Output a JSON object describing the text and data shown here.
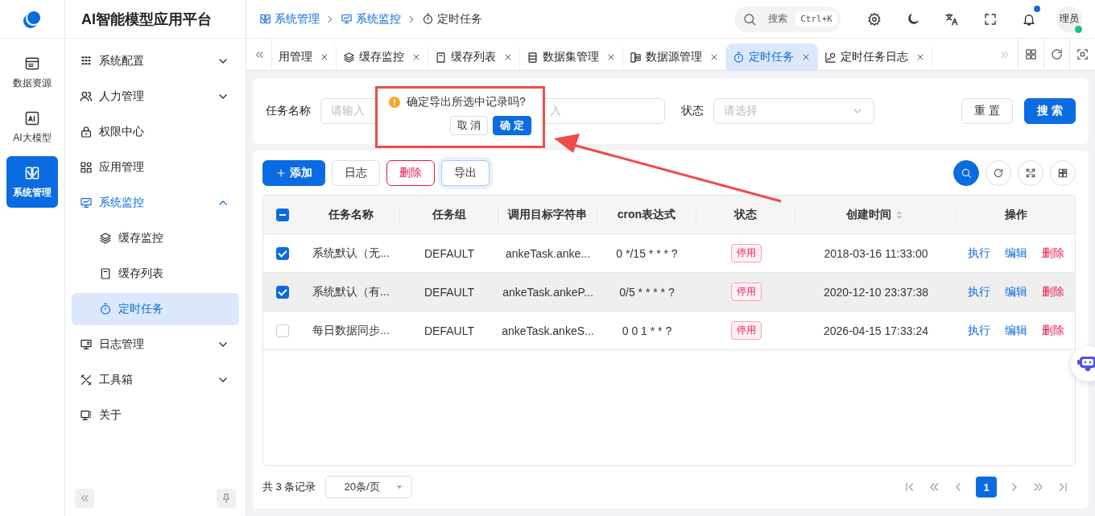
{
  "rail": {
    "items": [
      {
        "label": "数据资源",
        "selected": false
      },
      {
        "label": "AI大模型",
        "selected": false
      },
      {
        "label": "系统管理",
        "selected": true
      }
    ]
  },
  "sidebar": {
    "title": "AI智能模型应用平台",
    "items": [
      {
        "label": "系统配置",
        "kind": "group",
        "expanded": false
      },
      {
        "label": "人力管理",
        "kind": "group",
        "expanded": false
      },
      {
        "label": "权限中心",
        "kind": "link",
        "selected": false
      },
      {
        "label": "应用管理",
        "kind": "link",
        "selected": false
      },
      {
        "label": "系统监控",
        "kind": "group",
        "expanded": true,
        "children": [
          {
            "label": "缓存监控",
            "selected": false
          },
          {
            "label": "缓存列表",
            "selected": false
          },
          {
            "label": "定时任务",
            "selected": true
          }
        ]
      },
      {
        "label": "日志管理",
        "kind": "group",
        "expanded": false
      },
      {
        "label": "工具箱",
        "kind": "group",
        "expanded": false
      },
      {
        "label": "关于",
        "kind": "link",
        "selected": false
      }
    ]
  },
  "header": {
    "breadcrumb": [
      "系统管理",
      "系统监控",
      "定时任务"
    ],
    "search": {
      "placeholder": "搜索",
      "shortcut": "Ctrl+K"
    },
    "has_unread": true,
    "avatar": {
      "label": "理员",
      "online": true
    }
  },
  "tabs": [
    {
      "label": "用管理",
      "selected": false
    },
    {
      "label": "缓存监控",
      "selected": false
    },
    {
      "label": "缓存列表",
      "selected": false
    },
    {
      "label": "数据集管理",
      "selected": false
    },
    {
      "label": "数据源管理",
      "selected": false
    },
    {
      "label": "定时任务",
      "selected": true
    },
    {
      "label": "定时任务日志",
      "selected": false
    }
  ],
  "filters": {
    "fields": [
      {
        "kind": "input",
        "label": "任务名称",
        "placeholder": "请输入"
      },
      {
        "kind": "covered",
        "placeholder": "入"
      },
      {
        "kind": "select",
        "label": "状态",
        "placeholder": "请选择"
      }
    ],
    "buttons": [
      {
        "label": "重 置",
        "kind": "default"
      },
      {
        "label": "搜 索",
        "kind": "primary"
      }
    ]
  },
  "popconfirm": {
    "message": "确定导出所选中记录吗?",
    "cancel": "取 消",
    "ok": "确 定"
  },
  "toolbar": [
    {
      "label": "添加",
      "kind": "primary"
    },
    {
      "label": "日志",
      "kind": "default"
    },
    {
      "label": "删除",
      "kind": "danger"
    },
    {
      "label": "导出",
      "kind": "focused"
    }
  ],
  "table": {
    "indeterminate": true,
    "columns": [
      {
        "label": "任务名称"
      },
      {
        "label": "任务组"
      },
      {
        "label": "调用目标字符串"
      },
      {
        "label": "cron表达式"
      },
      {
        "label": "状态"
      },
      {
        "label": "创建时间",
        "sortable": true
      },
      {
        "label": "操作"
      }
    ],
    "rows": [
      {
        "checked": true,
        "hovered": false,
        "name": "系统默认（无...",
        "group": "DEFAULT",
        "target": "ankeTask.anke...",
        "cron": "0 */15 * * * ?",
        "status": "停用",
        "created": "2018-03-16 11:33:00",
        "actions": [
          "执行",
          "编辑",
          "删除"
        ]
      },
      {
        "checked": true,
        "hovered": true,
        "name": "系统默认（有...",
        "group": "DEFAULT",
        "target": "ankeTask.ankeP...",
        "cron": "0/5 * * * * ?",
        "status": "停用",
        "created": "2020-12-10 23:37:38",
        "actions": [
          "执行",
          "编辑",
          "删除"
        ]
      },
      {
        "checked": false,
        "hovered": false,
        "name": "每日数据同步...",
        "group": "DEFAULT",
        "target": "ankeTask.ankeS...",
        "cron": "0 0 1 * * ?",
        "status": "停用",
        "created": "2026-04-15 17:33:24",
        "actions": [
          "执行",
          "编辑",
          "删除"
        ]
      }
    ]
  },
  "pagination": {
    "total": "共 3 条记录",
    "page_size": "20条/页",
    "pages": [
      {
        "label": "1",
        "selected": true
      }
    ]
  }
}
